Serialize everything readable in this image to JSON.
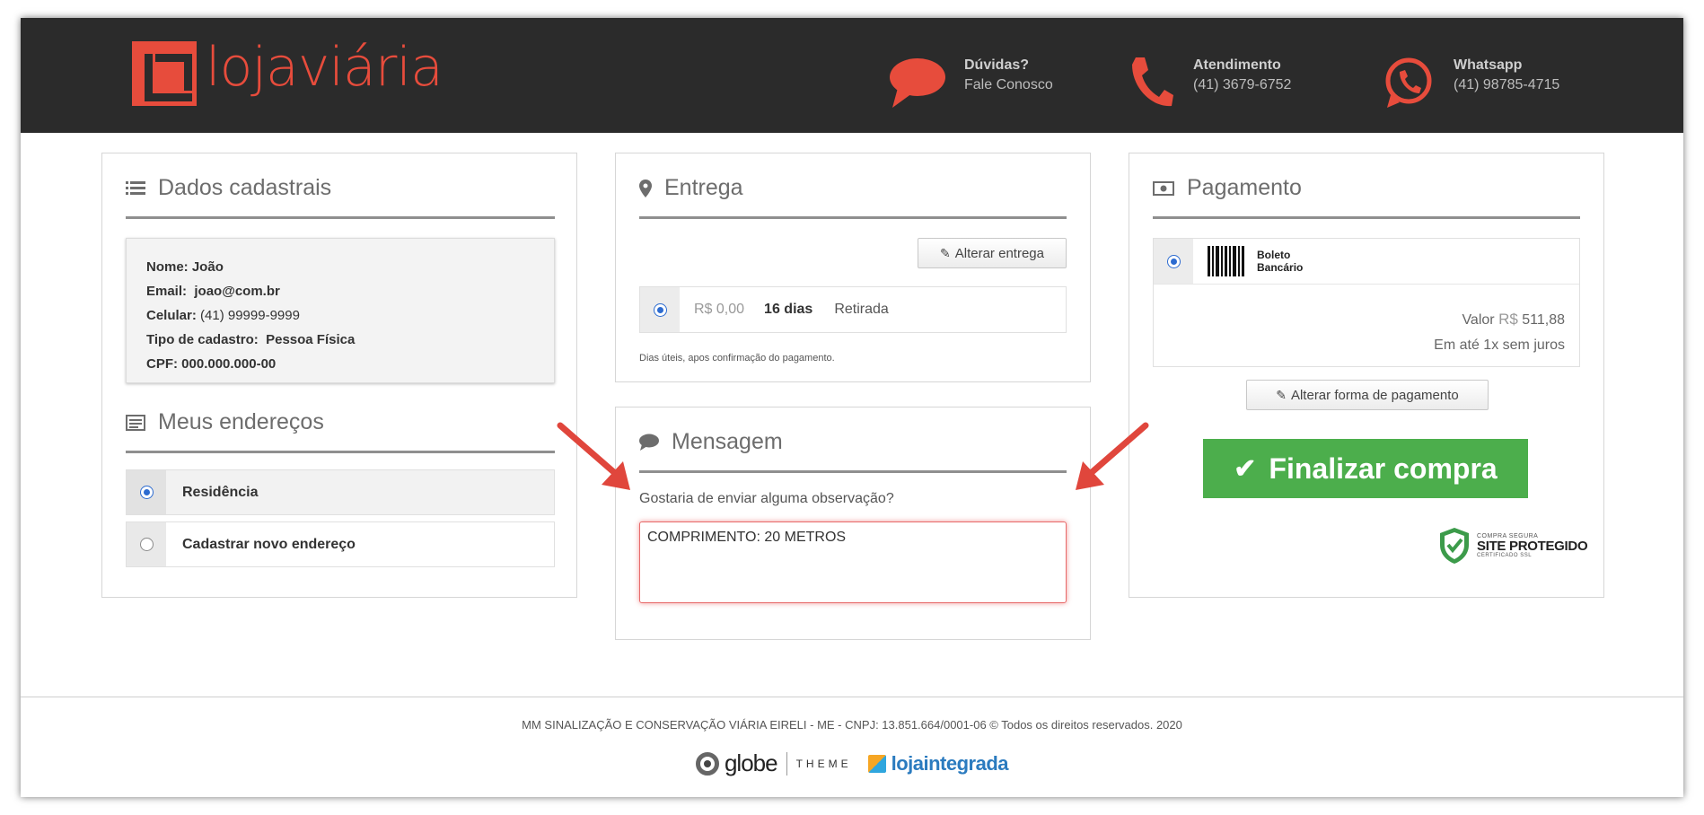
{
  "header": {
    "logo_text": "lojaviária",
    "contacts": [
      {
        "icon": "chat-bubble-icon",
        "title": "Dúvidas?",
        "subtitle": "Fale Conosco"
      },
      {
        "icon": "phone-icon",
        "title": "Atendimento",
        "subtitle": "(41) 3679-6752"
      },
      {
        "icon": "whatsapp-icon",
        "title": "Whatsapp",
        "subtitle": "(41) 98785-4715"
      }
    ]
  },
  "dados": {
    "title": "Dados cadastrais",
    "nome_label": "Nome:",
    "nome": "João",
    "email_label": "Email:",
    "email": "joao@com.br",
    "celular_label": "Celular:",
    "celular": "(41) 99999-9999",
    "tipo_label": "Tipo de cadastro:",
    "tipo": "Pessoa Física",
    "cpf_label": "CPF:",
    "cpf": "000.000.000-00"
  },
  "enderecos": {
    "title": "Meus endereços",
    "items": [
      {
        "label": "Residência",
        "selected": true
      },
      {
        "label": "Cadastrar novo endereço",
        "selected": false
      }
    ]
  },
  "entrega": {
    "title": "Entrega",
    "alterar_label": "Alterar entrega",
    "option": {
      "price": "R$ 0,00",
      "days": "16 dias",
      "method": "Retirada"
    },
    "note": "Dias úteis, apos confirmação do pagamento."
  },
  "mensagem": {
    "title": "Mensagem",
    "question": "Gostaria de enviar alguma observação?",
    "value": "COMPRIMENTO: 20 METROS"
  },
  "pagamento": {
    "title": "Pagamento",
    "method_line1": "Boleto",
    "method_line2": "Bancário",
    "valor_label": "Valor",
    "currency": "R$",
    "valor": "511,88",
    "parcelas": "Em até 1x sem juros",
    "alterar_label": "Alterar forma de pagamento",
    "finalizar_label": "Finalizar compra",
    "seal_line1": "COMPRA SEGURA",
    "seal_line2": "SITE PROTEGIDO",
    "seal_line3": "CERTIFICADO SSL"
  },
  "footer": {
    "copyright": "MM SINALIZAÇÃO E CONSERVAÇÃO VIÁRIA EIRELI - ME - CNPJ: 13.851.664/0001-06 © Todos os direitos reservados. 2020",
    "brand1": "globe",
    "brand2": "THEME",
    "brand3": "lojaintegrada"
  },
  "colors": {
    "header_bg": "#2b2b2b",
    "brand_red": "#e74c3c",
    "finalize_green": "#4cae4c",
    "radio_blue": "#2c6bd0",
    "annotation_arrow": "#e0463c"
  }
}
